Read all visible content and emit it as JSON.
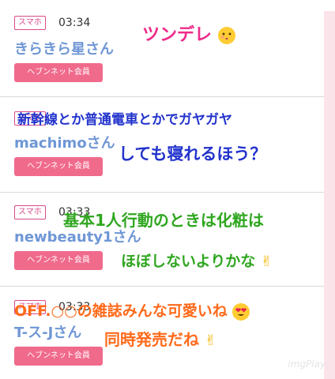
{
  "posts": [
    {
      "tag": "スマホ",
      "time": "03:34",
      "name": "きらきら星さん",
      "member": "ヘブンネット会員"
    },
    {
      "tag": "スマホ",
      "time": "",
      "name": "machimoさん",
      "member": "ヘブンネット会員"
    },
    {
      "tag": "スマホ",
      "time": "03:33",
      "name": "newbeauty1さん",
      "member": "ヘブンネット会員"
    },
    {
      "tag": "スマホ",
      "time": "03:33",
      "name": "T-ス-Jさん",
      "member": "ヘブンネット会員"
    }
  ],
  "stickers": [
    {
      "text": "ツンデレ",
      "color": "#ee2a8a"
    },
    {
      "text": "新幹線とか普通電車とかでガヤガヤ",
      "color": "#2233cc"
    },
    {
      "text": "しても寝れるほう？",
      "color": "#2233cc"
    },
    {
      "text": "基本1人行動のときは化粧は",
      "color": "#2fa61f"
    },
    {
      "text": "ほぼしないよりかな",
      "color": "#2fa61f"
    },
    {
      "text": "OFF.○○の雑誌みんな可愛いね",
      "color": "#ff6a1a"
    },
    {
      "text": "同時発売だね",
      "color": "#ff6a1a"
    }
  ],
  "watermark": "imgPlay",
  "icons": [
    "kiss-emoji-icon",
    "victory-hand-icon",
    "heart-eyes-emoji-icon"
  ]
}
